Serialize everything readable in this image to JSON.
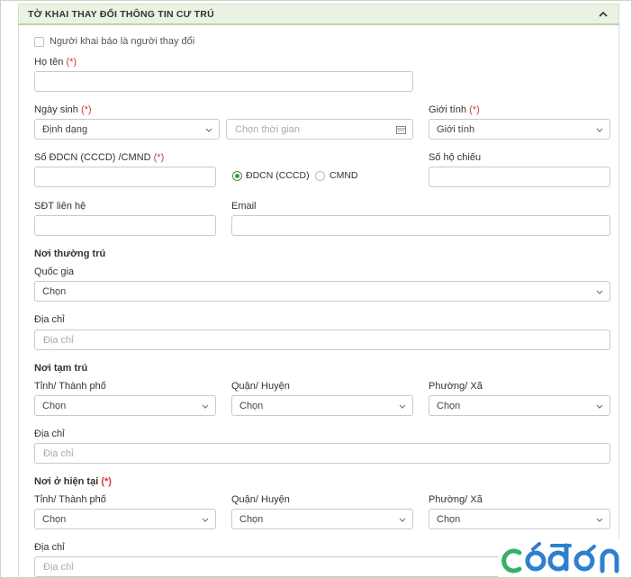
{
  "panel": {
    "title": "TỜ KHAI THAY ĐỔI THÔNG TIN CƯ TRÚ",
    "collapse_icon": "chevron-up-icon"
  },
  "declarant_checkbox": {
    "label": "Người khai báo là người thay đổi",
    "checked": false
  },
  "full_name": {
    "label": "Họ tên",
    "required_mark": "(*)",
    "value": ""
  },
  "birth_date": {
    "label": "Ngày sinh",
    "required_mark": "(*)",
    "format_value": "Định dạng",
    "date_placeholder": "Chọn thời gian"
  },
  "gender": {
    "label": "Giới tính",
    "required_mark": "(*)",
    "value": "Giới tính"
  },
  "id_number": {
    "label": "Số ĐDCN (CCCD) /CMND",
    "required_mark": "(*)",
    "value": "",
    "options": [
      {
        "label": "ĐDCN (CCCD)",
        "selected": true
      },
      {
        "label": "CMND",
        "selected": false
      }
    ]
  },
  "passport": {
    "label": "Số hộ chiếu",
    "value": ""
  },
  "phone": {
    "label": "SĐT liên hệ",
    "value": ""
  },
  "email": {
    "label": "Email",
    "value": ""
  },
  "permanent": {
    "heading": "Nơi thường trú",
    "country_label": "Quốc gia",
    "country_value": "Chọn",
    "address_label": "Địa chỉ",
    "address_placeholder": "Địa chỉ"
  },
  "temporary": {
    "heading": "Nơi tạm trú",
    "province_label": "Tỉnh/ Thành phố",
    "province_value": "Chọn",
    "district_label": "Quận/ Huyện",
    "district_value": "Chọn",
    "ward_label": "Phường/ Xã",
    "ward_value": "Chọn",
    "address_label": "Địa chỉ",
    "address_placeholder": "Địa chỉ"
  },
  "current": {
    "heading": "Nơi ở hiện tại",
    "required_mark": "(*)",
    "province_label": "Tỉnh/ Thành phố",
    "province_value": "Chọn",
    "district_label": "Quận/ Huyện",
    "district_value": "Chọn",
    "ward_label": "Phường/ Xã",
    "ward_value": "Chọn",
    "address_label": "Địa chỉ",
    "address_placeholder": "Địa chỉ"
  },
  "watermark": {
    "text": "cóđơn",
    "color_primary": "#2f7fd0",
    "color_accent": "#35b06a"
  },
  "colors": {
    "accent": "#3b9a4a",
    "required": "#d9363e",
    "header_bg": "#e9f3e4"
  }
}
